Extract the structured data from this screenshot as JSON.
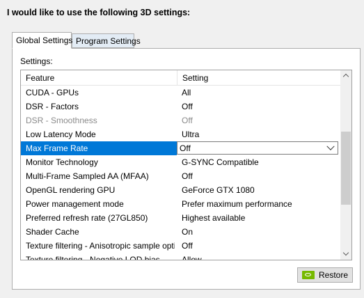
{
  "heading": "I would like to use the following 3D settings:",
  "tabs": [
    {
      "label": "Global Settings",
      "active": true
    },
    {
      "label": "Program Settings",
      "active": false
    }
  ],
  "settings_label": "Settings:",
  "columns": {
    "feature": "Feature",
    "setting": "Setting"
  },
  "rows": [
    {
      "feature": "CUDA - GPUs",
      "setting": "All"
    },
    {
      "feature": "DSR - Factors",
      "setting": "Off"
    },
    {
      "feature": "DSR - Smoothness",
      "setting": "Off",
      "disabled": true
    },
    {
      "feature": "Low Latency Mode",
      "setting": "Ultra"
    },
    {
      "feature": "Max Frame Rate",
      "setting": "Off",
      "selected": true
    },
    {
      "feature": "Monitor Technology",
      "setting": "G-SYNC Compatible"
    },
    {
      "feature": "Multi-Frame Sampled AA (MFAA)",
      "setting": "Off"
    },
    {
      "feature": "OpenGL rendering GPU",
      "setting": "GeForce GTX 1080"
    },
    {
      "feature": "Power management mode",
      "setting": "Prefer maximum performance"
    },
    {
      "feature": "Preferred refresh rate (27GL850)",
      "setting": "Highest available"
    },
    {
      "feature": "Shader Cache",
      "setting": "On"
    },
    {
      "feature": "Texture filtering - Anisotropic sample opti...",
      "setting": "Off"
    },
    {
      "feature": "Texture filtering - Negative LOD bias",
      "setting": "Allow"
    }
  ],
  "restore_button": {
    "label": "Restore",
    "icon": "nvidia-logo-icon"
  },
  "colors": {
    "selection": "#0078d7",
    "nvidia_green": "#76b900"
  }
}
